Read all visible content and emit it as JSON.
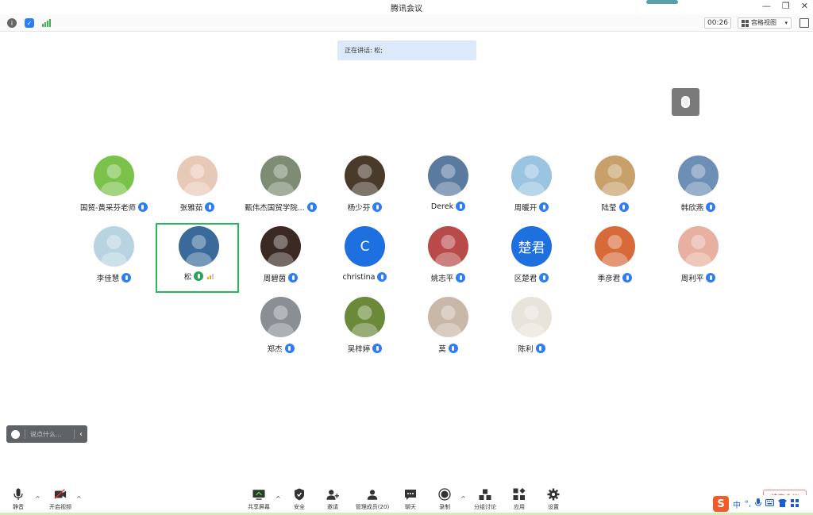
{
  "window": {
    "title": "腾讯会议",
    "minimize": "—",
    "restore": "❐",
    "close": "✕"
  },
  "toolbar": {
    "timer": "00:26",
    "view_mode": "宫格视图",
    "view_caret": "▾"
  },
  "speaking": {
    "text": "正在讲话: 松;"
  },
  "participants": [
    {
      "name": "国贸-黄采芬老师",
      "avatar_color": "#7bc24a"
    },
    {
      "name": "张雅茹",
      "avatar_color": "#e8c9b8"
    },
    {
      "name": "甄伟杰国贸学院...",
      "avatar_color": "#7d8c72"
    },
    {
      "name": "杨少芬",
      "avatar_color": "#4a3a2a"
    },
    {
      "name": "Derek",
      "avatar_color": "#5b7aa0"
    },
    {
      "name": "周暖开",
      "avatar_color": "#9ac4e0"
    },
    {
      "name": "陆莹",
      "avatar_color": "#c7a06a"
    },
    {
      "name": "韩欣燕",
      "avatar_color": "#6e8fb5"
    },
    {
      "name": "李佳慧",
      "avatar_color": "#b8d4e0"
    },
    {
      "name": "松",
      "avatar_color": "#3a6a9a"
    },
    {
      "name": "周碧茵",
      "avatar_color": "#3b2a24"
    },
    {
      "name": "christina",
      "avatar_color": "#1e6fe0",
      "letter": "C"
    },
    {
      "name": "姚志平",
      "avatar_color": "#b84a4a"
    },
    {
      "name": "区楚君",
      "avatar_color": "#1e6fe0",
      "letter": "楚君"
    },
    {
      "name": "季彦君",
      "avatar_color": "#d86a3a"
    },
    {
      "name": "周利平",
      "avatar_color": "#e8b0a0"
    },
    {
      "name": "郑杰",
      "avatar_color": "#8a8f96"
    },
    {
      "name": "吴梓婷",
      "avatar_color": "#6a8a3a"
    },
    {
      "name": "莫",
      "avatar_color": "#c9b8a8"
    },
    {
      "name": "陈利",
      "avatar_color": "#e8e4dc"
    }
  ],
  "chat": {
    "placeholder": "说点什么...",
    "collapse": "‹"
  },
  "bottom": {
    "mute": "静音",
    "video": "开启视频",
    "share": "共享屏幕",
    "security": "安全",
    "invite": "邀请",
    "members": "管理成员(20)",
    "chat": "聊天",
    "record": "录制",
    "breakout": "分组讨论",
    "apps": "应用",
    "settings": "设置",
    "end": "结束会议"
  },
  "ime": {
    "logo": "S",
    "lang": "中",
    "punct": "°,"
  }
}
